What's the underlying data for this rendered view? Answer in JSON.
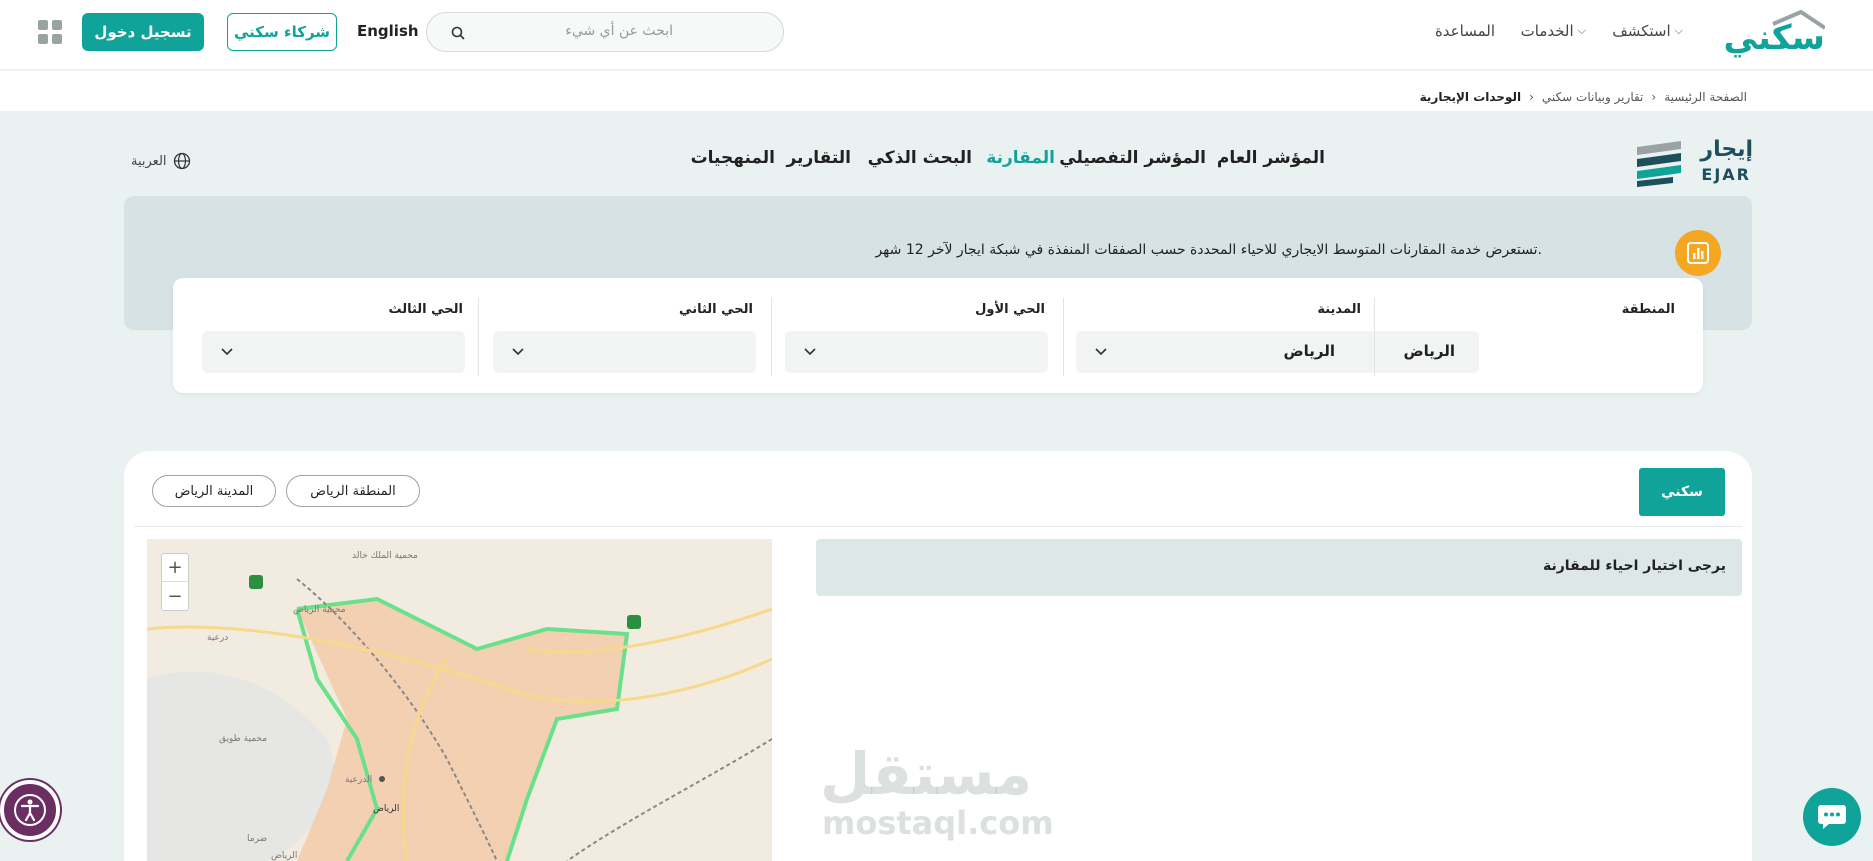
{
  "header": {
    "logo": "سكني",
    "nav": [
      {
        "label": "استكشف"
      },
      {
        "label": "الخدمات"
      },
      {
        "label": "المساعدة"
      }
    ],
    "search_placeholder": "ابحث عن أي شيء",
    "lang_switch": "English",
    "partners_label": "شركاء سكني",
    "login_label": "تسجيل دخول"
  },
  "breadcrumb": [
    "الصفحة الرئيسية",
    "تقارير وبيانات سكني",
    "الوحدات الإيجارية"
  ],
  "ejar": {
    "logo_ar": "إيجار",
    "logo_en": "EJAR",
    "nav": [
      {
        "label": "المؤشر العام",
        "active": false
      },
      {
        "label": "المؤشر التفصيلي",
        "active": false
      },
      {
        "label": "المقارنة",
        "active": true
      },
      {
        "label": "البحث الذكي",
        "active": false
      },
      {
        "label": "التقارير",
        "active": false
      },
      {
        "label": "المنهجيات",
        "active": false
      }
    ],
    "language": "العربية"
  },
  "info": {
    "text": "تستعرض خدمة المقارنات المتوسط الايجاري للاحياء المحددة حسب الصفقات المنفذة في شبكة ايجار لآخر 12 شهر."
  },
  "filters": [
    {
      "label": "المنطقة",
      "value": "الرياض"
    },
    {
      "label": "المدينة",
      "value": "الرياض"
    },
    {
      "label": "الحي الأول",
      "value": ""
    },
    {
      "label": "الحي الثاني",
      "value": ""
    },
    {
      "label": "الحي الثالث",
      "value": ""
    }
  ],
  "results": {
    "sakani_button": "سكني",
    "chips": [
      "المنطقة الرياض",
      "المدينة الرياض"
    ],
    "notice": "يرجى اختيار احياء للمقارنة",
    "map": {
      "zoom_in": "+",
      "zoom_out": "−",
      "labels": [
        "محمية الملك خالد",
        "محمية الرياض",
        "درعية",
        "محمية طويق",
        "الدرعية",
        "الرياض",
        "ضرما",
        "الرياض"
      ]
    }
  },
  "watermark": {
    "ar": "مستقل",
    "en": "mostaql.com"
  },
  "colors": {
    "brand": "#0fa39a",
    "accent": "#f5a623",
    "navy": "#1d4f5c"
  }
}
